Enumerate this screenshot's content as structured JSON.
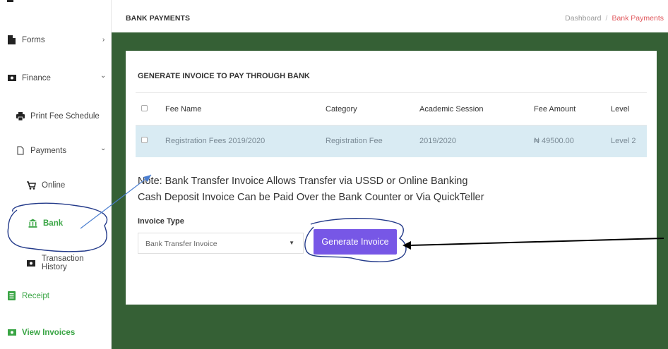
{
  "sidebar": {
    "items": [
      {
        "label": "Forms",
        "icon": "file-icon",
        "chevron": "›"
      },
      {
        "label": "Finance",
        "icon": "money-icon",
        "chevron": "⌄"
      },
      {
        "label": "Print Fee Schedule",
        "icon": "printer-icon"
      },
      {
        "label": "Payments",
        "icon": "document-icon",
        "chevron": "⌄"
      },
      {
        "label": "Online",
        "icon": "cart-icon"
      },
      {
        "label": "Bank",
        "icon": "bank-icon"
      },
      {
        "label": "Transaction History",
        "icon": "money-icon"
      },
      {
        "label": "Receipt",
        "icon": "receipt-icon"
      },
      {
        "label": "View Invoices",
        "icon": "money-icon"
      }
    ]
  },
  "header": {
    "title": "BANK PAYMENTS",
    "breadcrumb": [
      "Dashboard",
      "/",
      "Bank Payments"
    ]
  },
  "card": {
    "title": "GENERATE INVOICE TO PAY THROUGH BANK",
    "table": {
      "headers": [
        "Fee Name",
        "Category",
        "Academic Session",
        "Fee Amount",
        "Level"
      ],
      "rows": [
        [
          "Registration Fees 2019/2020",
          "Registration Fee",
          "2019/2020",
          "₦ 49500.00",
          "Level 2"
        ]
      ]
    },
    "note_line1": "Note: Bank Transfer Invoice Allows Transfer via USSD or Online Banking",
    "note_line2": "Cash Deposit Invoice Can be Paid Over the Bank Counter or Via QuickTeller",
    "invoice_type_label": "Invoice Type",
    "invoice_type_value": "Bank Transfer Invoice",
    "generate_button": "Generate Invoice"
  },
  "colors": {
    "accent": "#7757e6",
    "sidebar_active": "#3aa545",
    "background_green": "#356035",
    "row_highlight": "#d9ebf3",
    "breadcrumb_current": "#e0565b"
  }
}
